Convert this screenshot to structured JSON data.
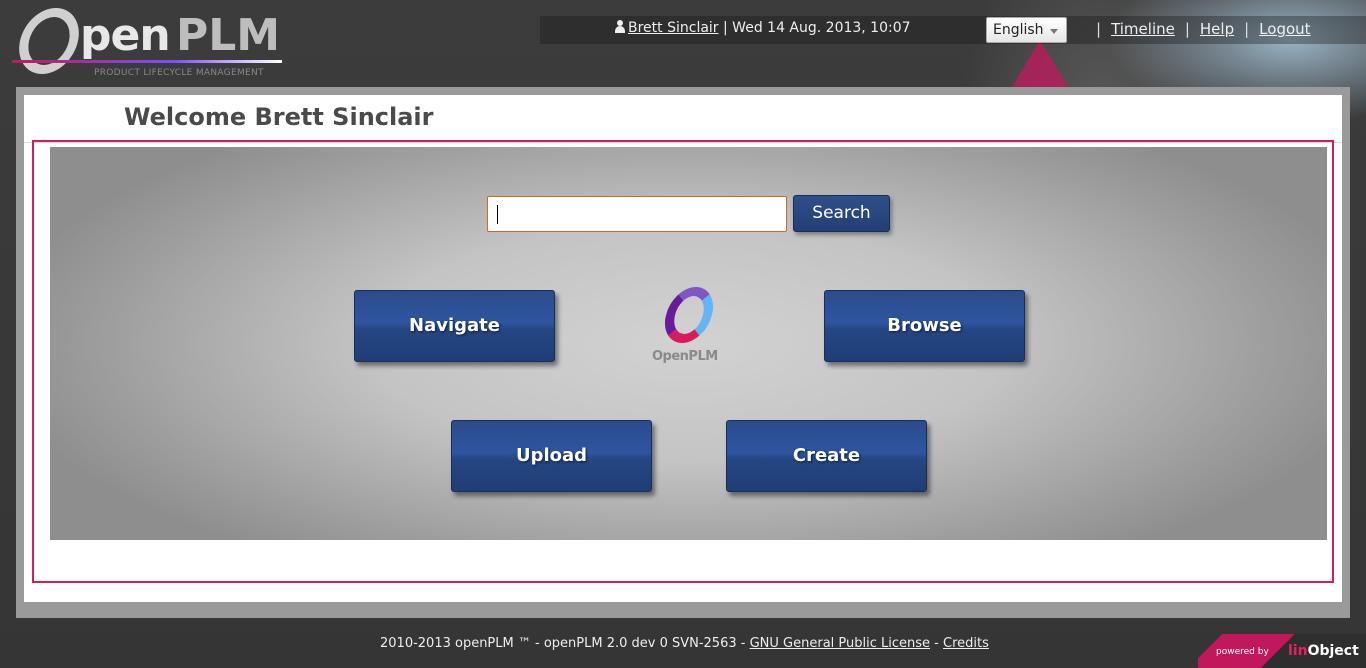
{
  "logo": {
    "name_part1": "pen",
    "name_part2": "PLM",
    "tagline": "PRODUCT LIFECYCLE MANAGEMENT"
  },
  "header": {
    "user_name": "Brett Sinclair",
    "datetime": "| Wed 14 Aug. 2013, 10:07",
    "language": "English",
    "nav": [
      {
        "label": "Timeline"
      },
      {
        "label": "Help"
      },
      {
        "label": "Logout"
      }
    ],
    "separator": "|"
  },
  "main": {
    "welcome": "Welcome Brett Sinclair",
    "search": {
      "value": "",
      "button_label": "Search"
    },
    "buttons": {
      "navigate": "Navigate",
      "browse": "Browse",
      "upload": "Upload",
      "create": "Create"
    },
    "center_logo_text": "OpenPLM"
  },
  "footer": {
    "text": "2010-2013 openPLM ™ - openPLM 2.0 dev 0 SVN-2563 - ",
    "license_link": "GNU General Public License",
    "dash": " - ",
    "credits_link": "Credits",
    "powered_by": "powered by",
    "company_l": "lin",
    "company_r": "Object"
  },
  "colors": {
    "accent_pink": "#d81b60",
    "button_blue": "#2b4c8b"
  }
}
